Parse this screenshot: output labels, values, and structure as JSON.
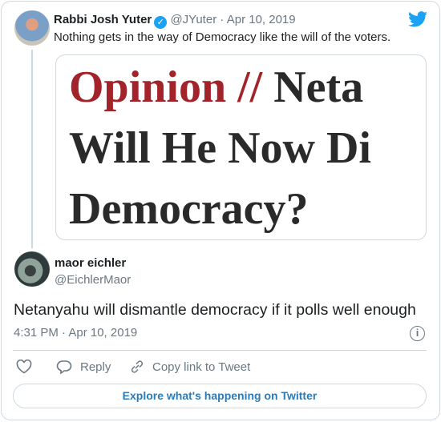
{
  "original_tweet": {
    "name": "Rabbi Josh Yuter",
    "handle": "@JYuter",
    "date": "Apr 10, 2019",
    "text": "Nothing gets in the way of Democracy like the will of the voters.",
    "media": {
      "line1_red": "Opinion //",
      "line1_dark": "Neta",
      "line2": "Will He Now Di",
      "line3": "Democracy?"
    }
  },
  "reply": {
    "name": "maor eichler",
    "handle": "@EichlerMaor",
    "text": "Netanyahu will dismantle democracy if it polls well enough",
    "timestamp": "4:31 PM · Apr 10, 2019"
  },
  "actions": {
    "reply": "Reply",
    "copy_link": "Copy link to Tweet"
  },
  "explore_button": "Explore what's happening on Twitter",
  "colors": {
    "accent": "#1da1f2",
    "link": "#2b7bb9",
    "media_red": "#a3232b"
  }
}
